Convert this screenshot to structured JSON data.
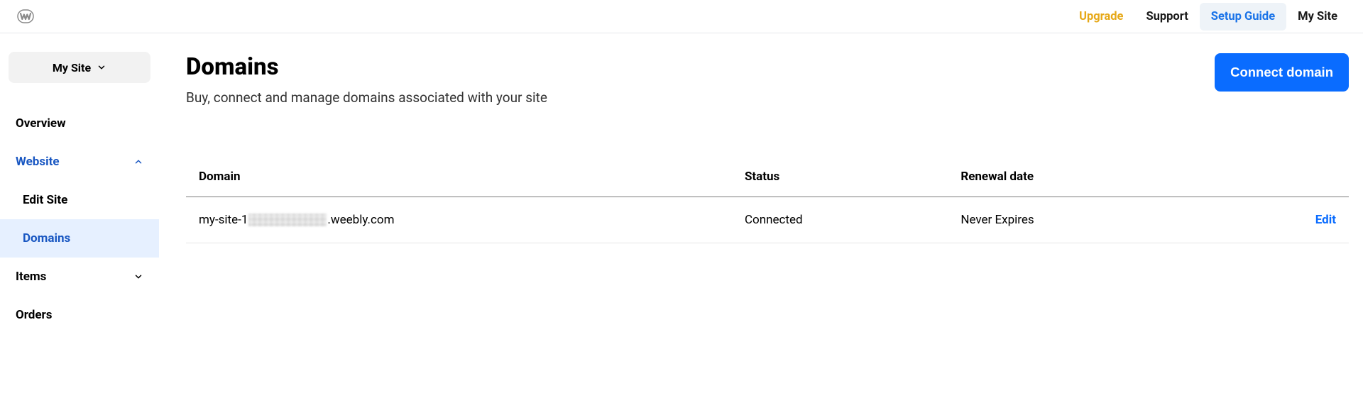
{
  "topnav": {
    "upgrade": "Upgrade",
    "support": "Support",
    "setup_guide": "Setup Guide",
    "my_site": "My Site"
  },
  "sidebar": {
    "site_switch_label": "My Site",
    "items": {
      "overview": "Overview",
      "website": "Website",
      "edit_site": "Edit Site",
      "domains": "Domains",
      "items_menu": "Items",
      "orders": "Orders"
    }
  },
  "page": {
    "title": "Domains",
    "subtitle": "Buy, connect and manage domains associated with your site",
    "connect_btn": "Connect domain"
  },
  "table": {
    "headers": {
      "domain": "Domain",
      "status": "Status",
      "renewal": "Renewal date"
    },
    "rows": [
      {
        "domain_prefix": "my-site-1",
        "domain_suffix": ".weebly.com",
        "status": "Connected",
        "renewal": "Never Expires",
        "action": "Edit"
      }
    ]
  }
}
